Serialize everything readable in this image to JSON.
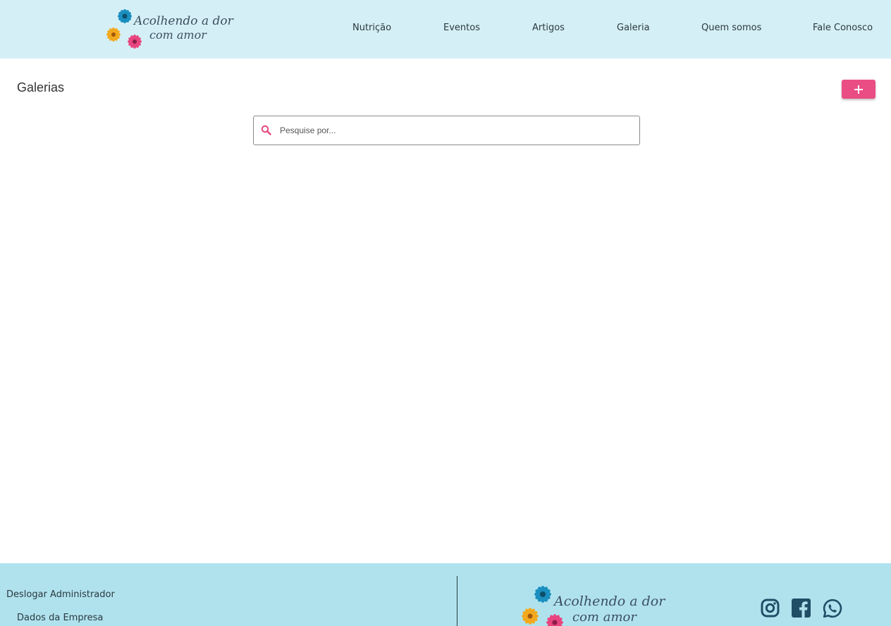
{
  "brand": {
    "logo_line1": "Acolhendo a dor",
    "logo_line2": "com amor",
    "colors": {
      "flower_blue": "#1b8fbf",
      "flower_orange": "#f2a91d",
      "flower_pink": "#e8457f",
      "text": "#3c4f60"
    }
  },
  "nav": {
    "items": [
      {
        "label": "Nutrição"
      },
      {
        "label": "Eventos"
      },
      {
        "label": "Artigos"
      },
      {
        "label": "Galeria"
      },
      {
        "label": "Quem somos"
      },
      {
        "label": "Fale Conosco"
      }
    ]
  },
  "main": {
    "title": "Galerias",
    "add_button_icon": "plus-icon",
    "search": {
      "placeholder": "Pesquise por...",
      "value": "",
      "icon": "search-icon"
    }
  },
  "footer": {
    "links": [
      {
        "label": "Deslogar Administrador"
      },
      {
        "label": "Dados da Empresa"
      }
    ],
    "social": [
      {
        "icon": "instagram-icon"
      },
      {
        "icon": "facebook-icon"
      },
      {
        "icon": "whatsapp-icon"
      }
    ]
  },
  "colors": {
    "header_bg": "#d5eff6",
    "footer_bg": "#b0e2ee",
    "accent": "#ea4d84"
  }
}
